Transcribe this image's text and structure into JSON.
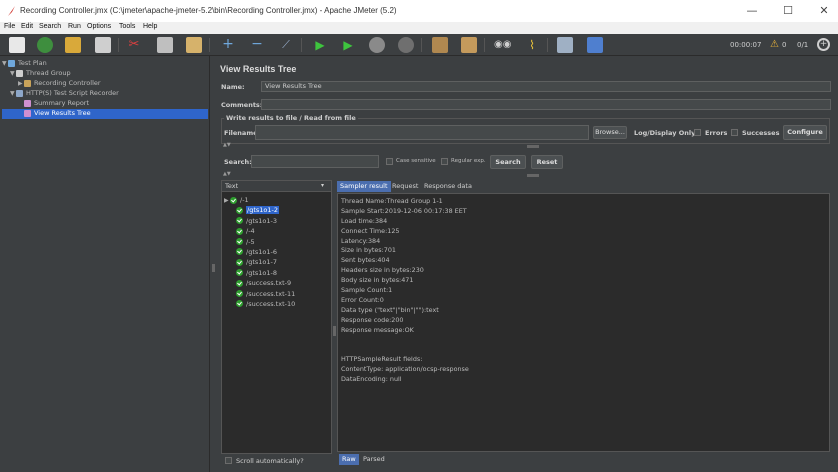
{
  "window": {
    "title": "Recording Controller.jmx (C:\\jmeter\\apache-jmeter-5.2\\bin\\Recording Controller.jmx) - Apache JMeter (5.2)"
  },
  "menu": [
    "File",
    "Edit",
    "Search",
    "Run",
    "Options",
    "Tools",
    "Help"
  ],
  "toolbar": {
    "timer": "00:00:07",
    "warnings": "0",
    "threads": "0/1",
    "buttons": [
      "new",
      "templates",
      "open",
      "save",
      "cut",
      "copy",
      "paste",
      "expand",
      "collapse",
      "toggle",
      "start",
      "start-no-pauses",
      "stop",
      "shutdown",
      "clear",
      "clear-all",
      "search",
      "reset-search",
      "function-helper",
      "help"
    ]
  },
  "tree": [
    {
      "label": "Test Plan",
      "indent": 0,
      "arrow": "▼",
      "icon": "flask",
      "color": "#6fa8dc"
    },
    {
      "label": "Thread Group",
      "indent": 1,
      "arrow": "▼",
      "icon": "gear",
      "color": "#cfcfcf"
    },
    {
      "label": "Recording Controller",
      "indent": 2,
      "arrow": "▶",
      "icon": "controller",
      "color": "#c9a35a"
    },
    {
      "label": "HTTP(S) Test Script Recorder",
      "indent": 1,
      "arrow": "▼",
      "icon": "recorder",
      "color": "#8da7c9"
    },
    {
      "label": "Summary Report",
      "indent": 2,
      "arrow": "",
      "icon": "chart",
      "color": "#d08fd0"
    },
    {
      "label": "View Results Tree",
      "indent": 2,
      "arrow": "",
      "icon": "chart",
      "color": "#d08fd0",
      "selected": true
    }
  ],
  "panel": {
    "title": "View Results Tree",
    "name_label": "Name:",
    "name_value": "View Results Tree",
    "comments_label": "Comments:",
    "comments_value": "",
    "file_group_title": "Write results to file / Read from file",
    "filename_label": "Filename",
    "filename_value": "",
    "browse_label": "Browse...",
    "log_display_label": "Log/Display Only:",
    "errors_label": "Errors",
    "successes_label": "Successes",
    "configure_label": "Configure",
    "search_label": "Search:",
    "search_value": "",
    "case_sensitive_label": "Case sensitive",
    "regular_exp_label": "Regular exp.",
    "search_button": "Search",
    "reset_button": "Reset",
    "renderer_value": "Text",
    "scroll_auto_label": "Scroll automatically?"
  },
  "results": [
    {
      "label": "/-1",
      "expanded": true
    },
    {
      "label": "/gts1o1-2",
      "selected": true
    },
    {
      "label": "/gts1o1-3"
    },
    {
      "label": "/-4"
    },
    {
      "label": "/-5"
    },
    {
      "label": "/gts1o1-6"
    },
    {
      "label": "/gts1o1-7"
    },
    {
      "label": "/gts1o1-8"
    },
    {
      "label": "/success.txt-9"
    },
    {
      "label": "/success.txt-11"
    },
    {
      "label": "/success.txt-10"
    }
  ],
  "detail_tabs": [
    "Sampler result",
    "Request",
    "Response data"
  ],
  "bottom_tabs": [
    "Raw",
    "Parsed"
  ],
  "sampler_result": [
    "Thread Name:Thread Group 1-1",
    "Sample Start:2019-12-06 00:17:38 EET",
    "Load time:384",
    "Connect Time:125",
    "Latency:384",
    "Size in bytes:701",
    "Sent bytes:404",
    "Headers size in bytes:230",
    "Body size in bytes:471",
    "Sample Count:1",
    "Error Count:0",
    "Data type (\"text\"|\"bin\"|\"\"):text",
    "Response code:200",
    "Response message:OK",
    "",
    "",
    "HTTPSampleResult fields:",
    "ContentType: application/ocsp-response",
    "DataEncoding: null"
  ]
}
